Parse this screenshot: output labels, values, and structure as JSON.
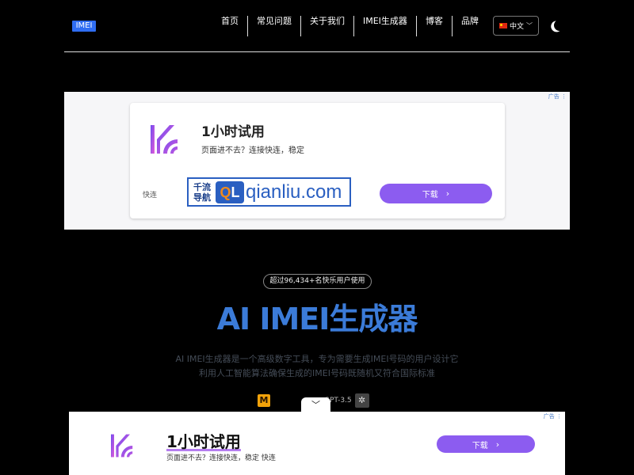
{
  "header": {
    "logo_text": "IMEI",
    "nav": [
      "首页",
      "常见问题",
      "关于我们",
      "IMEI生成器",
      "博客",
      "品牌"
    ],
    "language": "中文"
  },
  "ad1": {
    "tag": "广告",
    "title": "1小时试用",
    "subtitle": "页面进不去？连接快连，稳定",
    "brand": "快连",
    "banner_cn_line1": "千流",
    "banner_cn_line2": "导航",
    "banner_ql": "Q",
    "banner_ql2": "L",
    "banner_domain": "qianliu.com",
    "download": "下载"
  },
  "hero": {
    "badge": "超过96,434+名快乐用户使用",
    "title": "AI IMEI生成器",
    "desc_line1": "AI IMEI生成器是一个高级数字工具，专为需要生成IMEI号码的用户设计它",
    "desc_line2": "利用人工智能算法确保生成的IMEI号码既随机又符合国际标准",
    "model_label": "GPT-3.5"
  },
  "ad2": {
    "tag": "广告",
    "title": "1小时试用",
    "subtitle": "页面进不去？连接快连，稳定 快连",
    "download": "下载"
  },
  "colors": {
    "accent": "#3b7bd8",
    "button": "#8c5cf0",
    "logo_bg": "#2f6df2"
  }
}
